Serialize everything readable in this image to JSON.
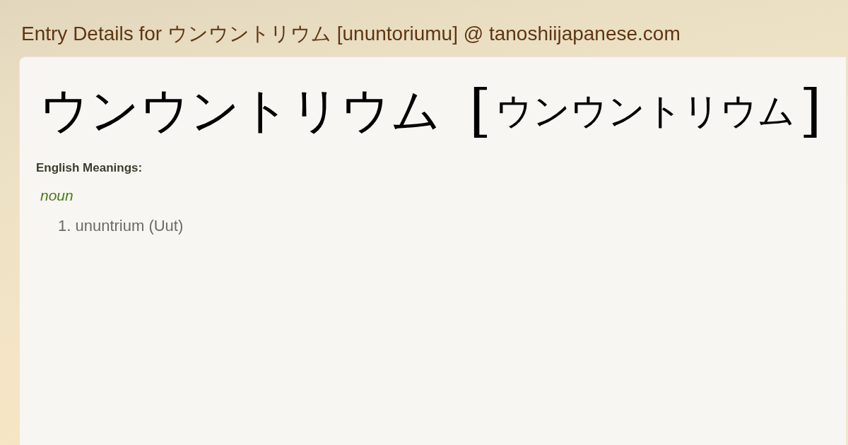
{
  "page_title": "Entry Details for ウンウントリウム [ununtoriumu] @ tanoshiijapanese.com",
  "entry": {
    "word": "ウンウントリウム",
    "reading": {
      "open": "[",
      "text": "ウンウントリウム",
      "close": "]"
    }
  },
  "meanings_label": "English Meanings:",
  "senses": [
    {
      "part_of_speech": "noun",
      "meanings": [
        {
          "number": "1.",
          "text": "ununtrium (Uut)"
        }
      ]
    }
  ]
}
